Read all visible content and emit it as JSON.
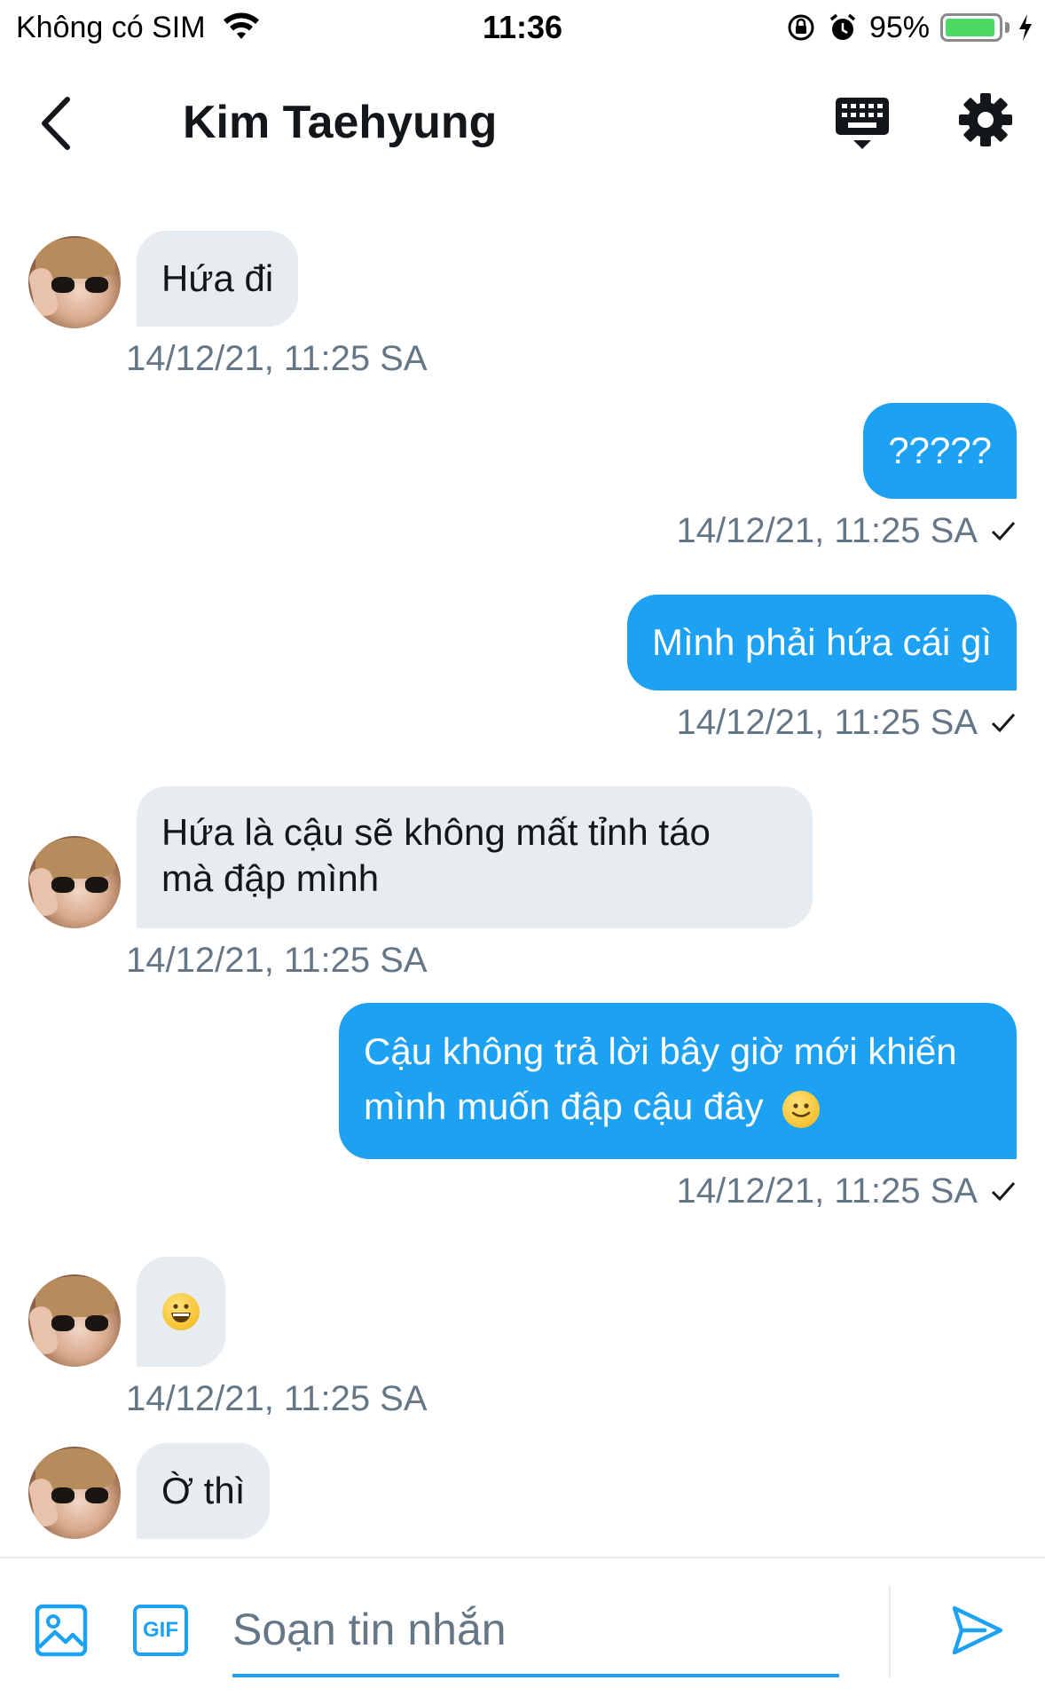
{
  "status_bar": {
    "carrier": "Không có SIM",
    "time": "11:36",
    "battery": "95%",
    "battery_level": 0.95
  },
  "header": {
    "title": "Kim Taehyung",
    "icons": [
      "back-arrow-icon",
      "keyboard-icon",
      "gear-icon"
    ]
  },
  "messages": [
    {
      "direction": "in",
      "text": "Hứa đi",
      "timestamp": "14/12/21, 11:25 SA"
    },
    {
      "direction": "out",
      "text": "?????",
      "timestamp": "14/12/21, 11:25 SA"
    },
    {
      "direction": "out",
      "text": "Mình phải hứa cái gì",
      "timestamp": "14/12/21, 11:25 SA"
    },
    {
      "direction": "in",
      "text_line1": "Hứa là cậu sẽ không mất tỉnh táo",
      "text_line2": "mà đập mình",
      "timestamp": "14/12/21, 11:25 SA"
    },
    {
      "direction": "out",
      "text_line1": "Cậu không trả lời bây giờ mới khiến",
      "text_line2": "mình muốn đập cậu đây",
      "emoji": "slightly-smiling-face",
      "timestamp": "14/12/21, 11:25 SA"
    },
    {
      "direction": "in",
      "emoji": "grinning-face",
      "timestamp": "14/12/21, 11:25 SA"
    },
    {
      "direction": "in",
      "text": "Ờ thì"
    }
  ],
  "composer": {
    "placeholder": "Soạn tin nhắn",
    "gif_label": "GIF"
  },
  "colors": {
    "accent": "#1da1f2",
    "incoming_bubble": "#e6ecf0",
    "timestamp": "#657786"
  }
}
